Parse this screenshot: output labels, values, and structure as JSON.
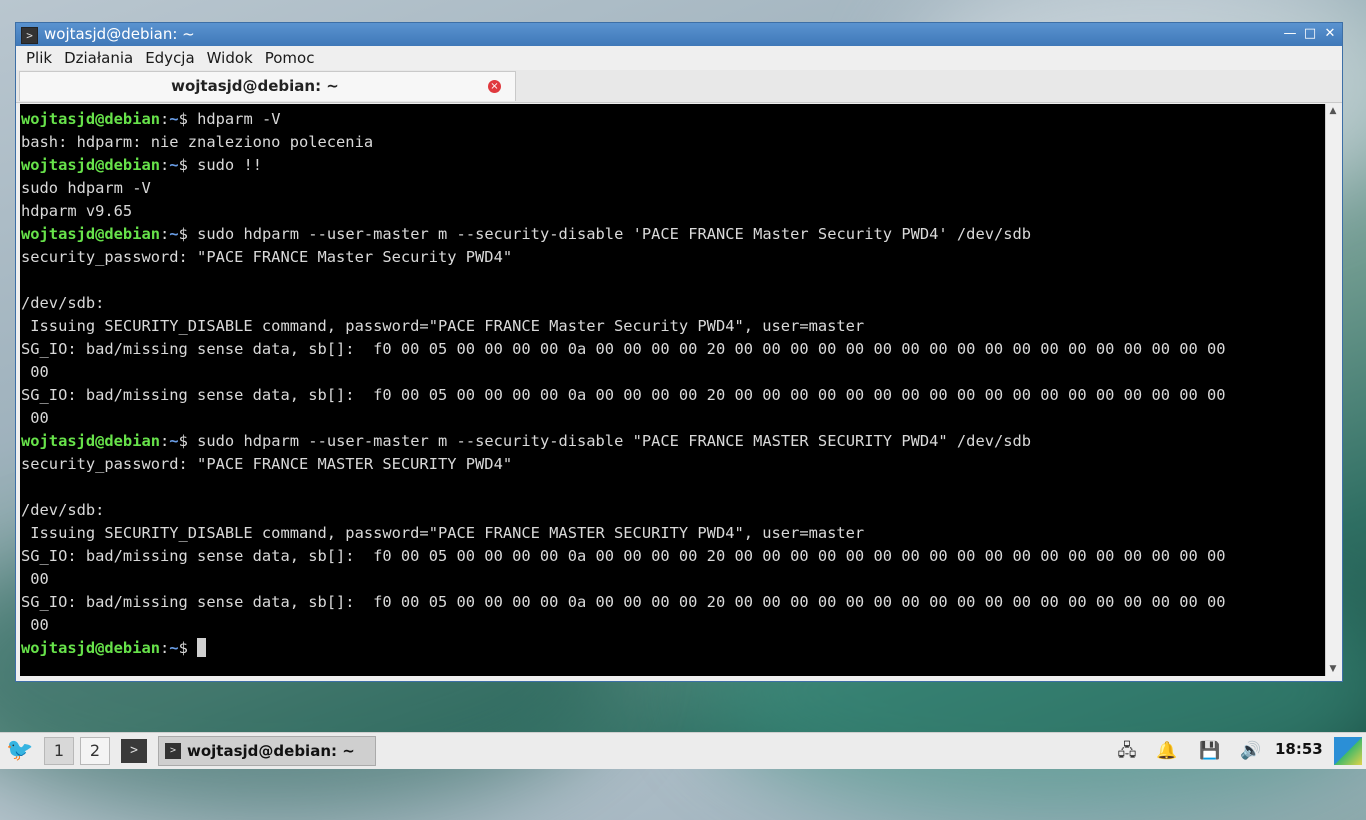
{
  "window": {
    "title": "wojtasjd@debian: ~",
    "minimize": "—",
    "maximize": "□",
    "close": "✕"
  },
  "menu": [
    "Plik",
    "Działania",
    "Edycja",
    "Widok",
    "Pomoc"
  ],
  "tab": {
    "label": "wojtasjd@debian: ~",
    "close": "×"
  },
  "prompt": {
    "user": "wojtasjd@debian",
    "sep": ":",
    "path": "~",
    "sign": "$ "
  },
  "terminal_lines": [
    {
      "prompt": true,
      "text": "hdparm -V"
    },
    {
      "text": "bash: hdparm: nie znaleziono polecenia"
    },
    {
      "prompt": true,
      "text": "sudo !!"
    },
    {
      "text": "sudo hdparm -V"
    },
    {
      "text": "hdparm v9.65"
    },
    {
      "prompt": true,
      "text": "sudo hdparm --user-master m --security-disable 'PACE FRANCE Master Security PWD4' /dev/sdb"
    },
    {
      "text": "security_password: \"PACE FRANCE Master Security PWD4\""
    },
    {
      "text": ""
    },
    {
      "text": "/dev/sdb:"
    },
    {
      "text": " Issuing SECURITY_DISABLE command, password=\"PACE FRANCE Master Security PWD4\", user=master"
    },
    {
      "text": "SG_IO: bad/missing sense data, sb[]:  f0 00 05 00 00 00 00 0a 00 00 00 00 20 00 00 00 00 00 00 00 00 00 00 00 00 00 00 00 00 00 00"
    },
    {
      "text": " 00"
    },
    {
      "text": "SG_IO: bad/missing sense data, sb[]:  f0 00 05 00 00 00 00 0a 00 00 00 00 20 00 00 00 00 00 00 00 00 00 00 00 00 00 00 00 00 00 00"
    },
    {
      "text": " 00"
    },
    {
      "prompt": true,
      "text": "sudo hdparm --user-master m --security-disable \"PACE FRANCE MASTER SECURITY PWD4\" /dev/sdb"
    },
    {
      "text": "security_password: \"PACE FRANCE MASTER SECURITY PWD4\""
    },
    {
      "text": ""
    },
    {
      "text": "/dev/sdb:"
    },
    {
      "text": " Issuing SECURITY_DISABLE command, password=\"PACE FRANCE MASTER SECURITY PWD4\", user=master"
    },
    {
      "text": "SG_IO: bad/missing sense data, sb[]:  f0 00 05 00 00 00 00 0a 00 00 00 00 20 00 00 00 00 00 00 00 00 00 00 00 00 00 00 00 00 00 00"
    },
    {
      "text": " 00"
    },
    {
      "text": "SG_IO: bad/missing sense data, sb[]:  f0 00 05 00 00 00 00 0a 00 00 00 00 20 00 00 00 00 00 00 00 00 00 00 00 00 00 00 00 00 00 00"
    },
    {
      "text": " 00"
    },
    {
      "prompt": true,
      "text": "",
      "cursor": true
    }
  ],
  "taskbar": {
    "workspaces": [
      "1",
      "2"
    ],
    "task_label": "wojtasjd@debian: ~",
    "clock": "18:53"
  },
  "colors": {
    "prompt_user": "#67e24a",
    "prompt_path": "#6a9ee8",
    "terminal_bg": "#000000",
    "titlebar": "#4a86c6"
  }
}
